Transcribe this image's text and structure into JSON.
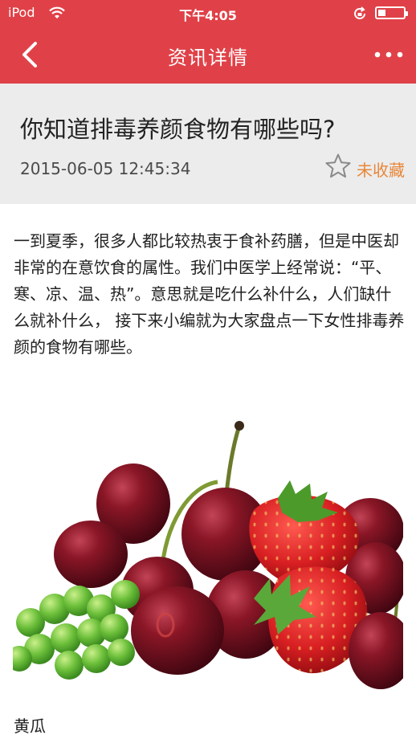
{
  "status_bar": {
    "carrier": "iPod",
    "time": "下午4:05",
    "battery_level": 0.3
  },
  "nav": {
    "title": "资讯详情",
    "back_icon": "chevron-left-icon",
    "more_icon": "more-dots-icon"
  },
  "article": {
    "title": "你知道排毒养颜食物有哪些吗?",
    "date": "2015-06-05 12:45:34",
    "favorite_label": "未收藏",
    "paragraph": "一到夏季，很多人都比较热衷于食补药膳，但是中医却非常的在意饮食的属性。我们中医学上经常说：“平、寒、凉、温、热”。意思就是吃什么补什么，人们缺什么就补什么，    接下来小编就为大家盘点一下女性排毒养颜的食物有哪些。",
    "subheading": "黄瓜"
  },
  "colors": {
    "accent": "#e04148",
    "favorite": "#e8873a",
    "header_bg": "#ececec"
  }
}
